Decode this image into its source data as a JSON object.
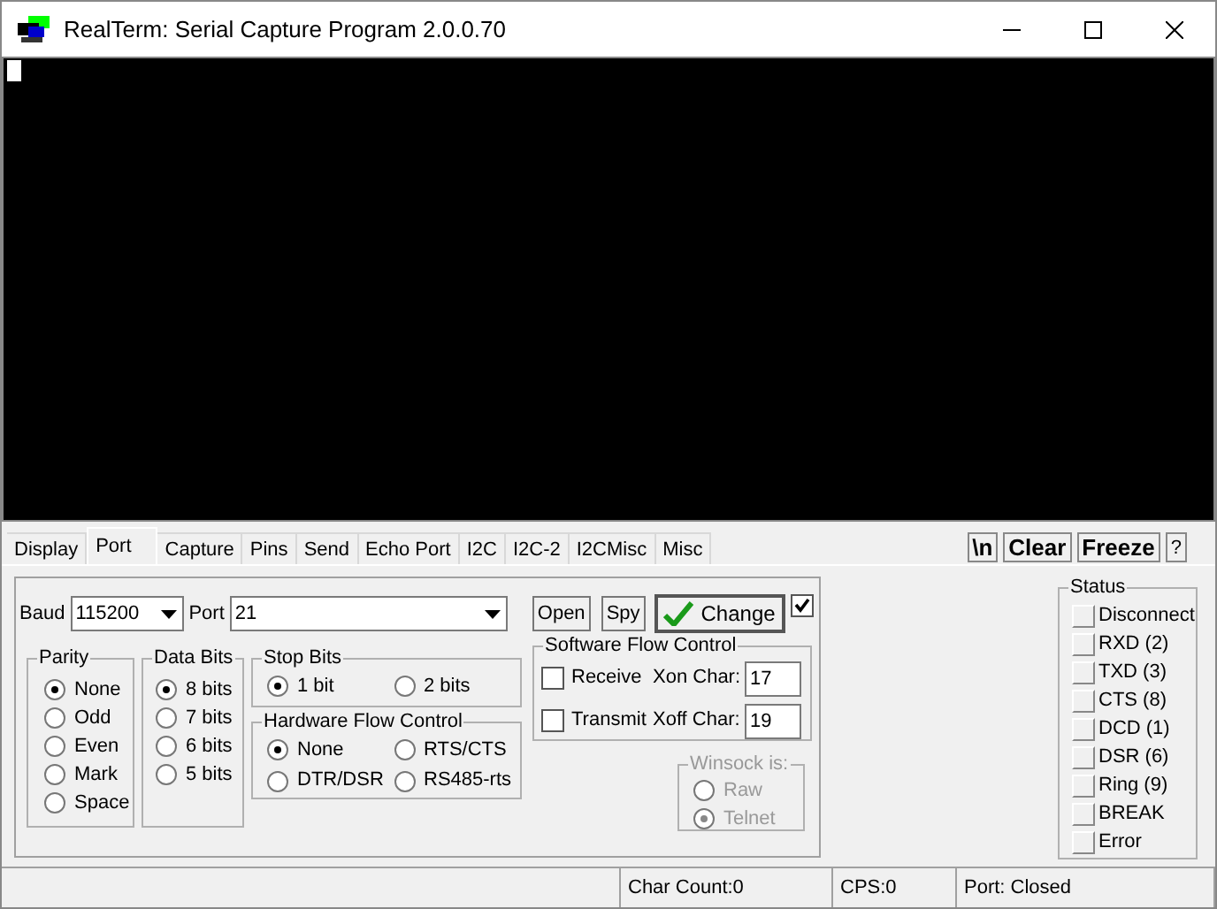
{
  "window": {
    "title": "RealTerm: Serial Capture Program 2.0.0.70"
  },
  "tabs": [
    {
      "label": "Display",
      "selected": false
    },
    {
      "label": "Port",
      "selected": true
    },
    {
      "label": "Capture",
      "selected": false
    },
    {
      "label": "Pins",
      "selected": false
    },
    {
      "label": "Send",
      "selected": false
    },
    {
      "label": "Echo Port",
      "selected": false
    },
    {
      "label": "I2C",
      "selected": false
    },
    {
      "label": "I2C-2",
      "selected": false
    },
    {
      "label": "I2CMisc",
      "selected": false
    },
    {
      "label": "Misc",
      "selected": false
    }
  ],
  "toolbar_buttons": [
    "\\n",
    "Clear",
    "Freeze",
    "?"
  ],
  "port": {
    "baud": {
      "label": "Baud",
      "value": "115200"
    },
    "port": {
      "label": "Port",
      "value": "21"
    },
    "buttons": [
      "Open",
      "Spy"
    ],
    "change_button": "Change",
    "change_checked": true,
    "parity": {
      "title": "Parity",
      "options": [
        {
          "label": "None",
          "selected": true
        },
        {
          "label": "Odd",
          "selected": false
        },
        {
          "label": "Even",
          "selected": false
        },
        {
          "label": "Mark",
          "selected": false
        },
        {
          "label": "Space",
          "selected": false
        }
      ]
    },
    "data_bits": {
      "title": "Data Bits",
      "options": [
        {
          "label": "8 bits",
          "selected": true
        },
        {
          "label": "7 bits",
          "selected": false
        },
        {
          "label": "6 bits",
          "selected": false
        },
        {
          "label": "5 bits",
          "selected": false
        }
      ]
    },
    "stop_bits": {
      "title": "Stop Bits",
      "options": [
        {
          "label": "1 bit",
          "selected": true
        },
        {
          "label": "2 bits",
          "selected": false
        }
      ]
    },
    "hardware_flow": {
      "title": "Hardware Flow Control",
      "options": [
        {
          "label": "None",
          "selected": true
        },
        {
          "label": "RTS/CTS",
          "selected": false
        },
        {
          "label": "DTR/DSR",
          "selected": false
        },
        {
          "label": "RS485-rts",
          "selected": false
        }
      ]
    },
    "software_flow": {
      "title": "Software Flow Control",
      "rows": [
        {
          "label": "Receive",
          "checked": false,
          "char_label": "Xon Char:",
          "value": "17"
        },
        {
          "label": "Transmit",
          "checked": false,
          "char_label": "Xoff Char:",
          "value": "19"
        }
      ]
    },
    "winsock": {
      "title": "Winsock is:",
      "disabled": true,
      "options": [
        {
          "label": "Raw",
          "selected": false
        },
        {
          "label": "Telnet",
          "selected": true
        }
      ]
    }
  },
  "status": {
    "title": "Status",
    "items": [
      {
        "label": "Disconnect",
        "on": false
      },
      {
        "label": "RXD (2)",
        "on": false
      },
      {
        "label": "TXD (3)",
        "on": false
      },
      {
        "label": "CTS (8)",
        "on": false
      },
      {
        "label": "DCD (1)",
        "on": false
      },
      {
        "label": "DSR (6)",
        "on": false
      },
      {
        "label": "Ring (9)",
        "on": false
      },
      {
        "label": "BREAK",
        "on": false
      },
      {
        "label": "Error",
        "on": false
      }
    ]
  },
  "status_bar": [
    "Char Count:0",
    "CPS:0",
    "Port: Closed"
  ]
}
